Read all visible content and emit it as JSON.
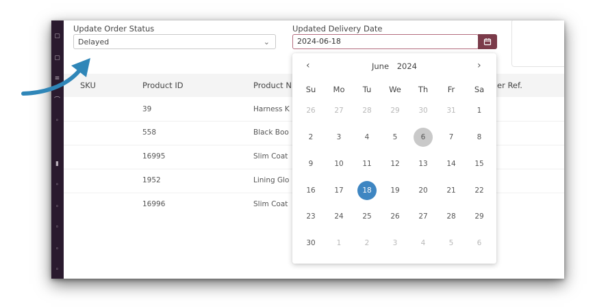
{
  "form": {
    "status_label": "Update Order Status",
    "status_value": "Delayed",
    "date_label": "Updated Delivery Date",
    "date_value": "2024-06-18"
  },
  "table": {
    "columns": [
      "SKU",
      "Product ID",
      "Product N",
      "er Ref."
    ],
    "rows": [
      {
        "sku": "",
        "product_id": "39",
        "product_name": "Harness K"
      },
      {
        "sku": "",
        "product_id": "558",
        "product_name": "Black Boo"
      },
      {
        "sku": "",
        "product_id": "16995",
        "product_name": "Slim Coat"
      },
      {
        "sku": "",
        "product_id": "1952",
        "product_name": "Lining Glo"
      },
      {
        "sku": "",
        "product_id": "16996",
        "product_name": "Slim Coat"
      }
    ]
  },
  "calendar": {
    "month": "June",
    "year": "2024",
    "prev": "‹",
    "next": "›",
    "weekdays": [
      "Su",
      "Mo",
      "Tu",
      "We",
      "Th",
      "Fr",
      "Sa"
    ],
    "weeks": [
      [
        "26",
        "27",
        "28",
        "29",
        "30",
        "31",
        "1"
      ],
      [
        "2",
        "3",
        "4",
        "5",
        "6",
        "7",
        "8"
      ],
      [
        "9",
        "10",
        "11",
        "12",
        "13",
        "14",
        "15"
      ],
      [
        "16",
        "17",
        "18",
        "19",
        "20",
        "21",
        "22"
      ],
      [
        "23",
        "24",
        "25",
        "26",
        "27",
        "28",
        "29"
      ],
      [
        "30",
        "1",
        "2",
        "3",
        "4",
        "5",
        "6"
      ]
    ],
    "today": "6",
    "selected": "18"
  },
  "colors": {
    "accent": "#7b3b4a",
    "selected": "#3e86c2",
    "arrow": "#2f86b8",
    "sidebar": "#2a1a2e"
  },
  "icons": {
    "date_button": "calendar-icon",
    "select": "chevron-down-icon",
    "annotation": "curved-arrow-icon"
  }
}
